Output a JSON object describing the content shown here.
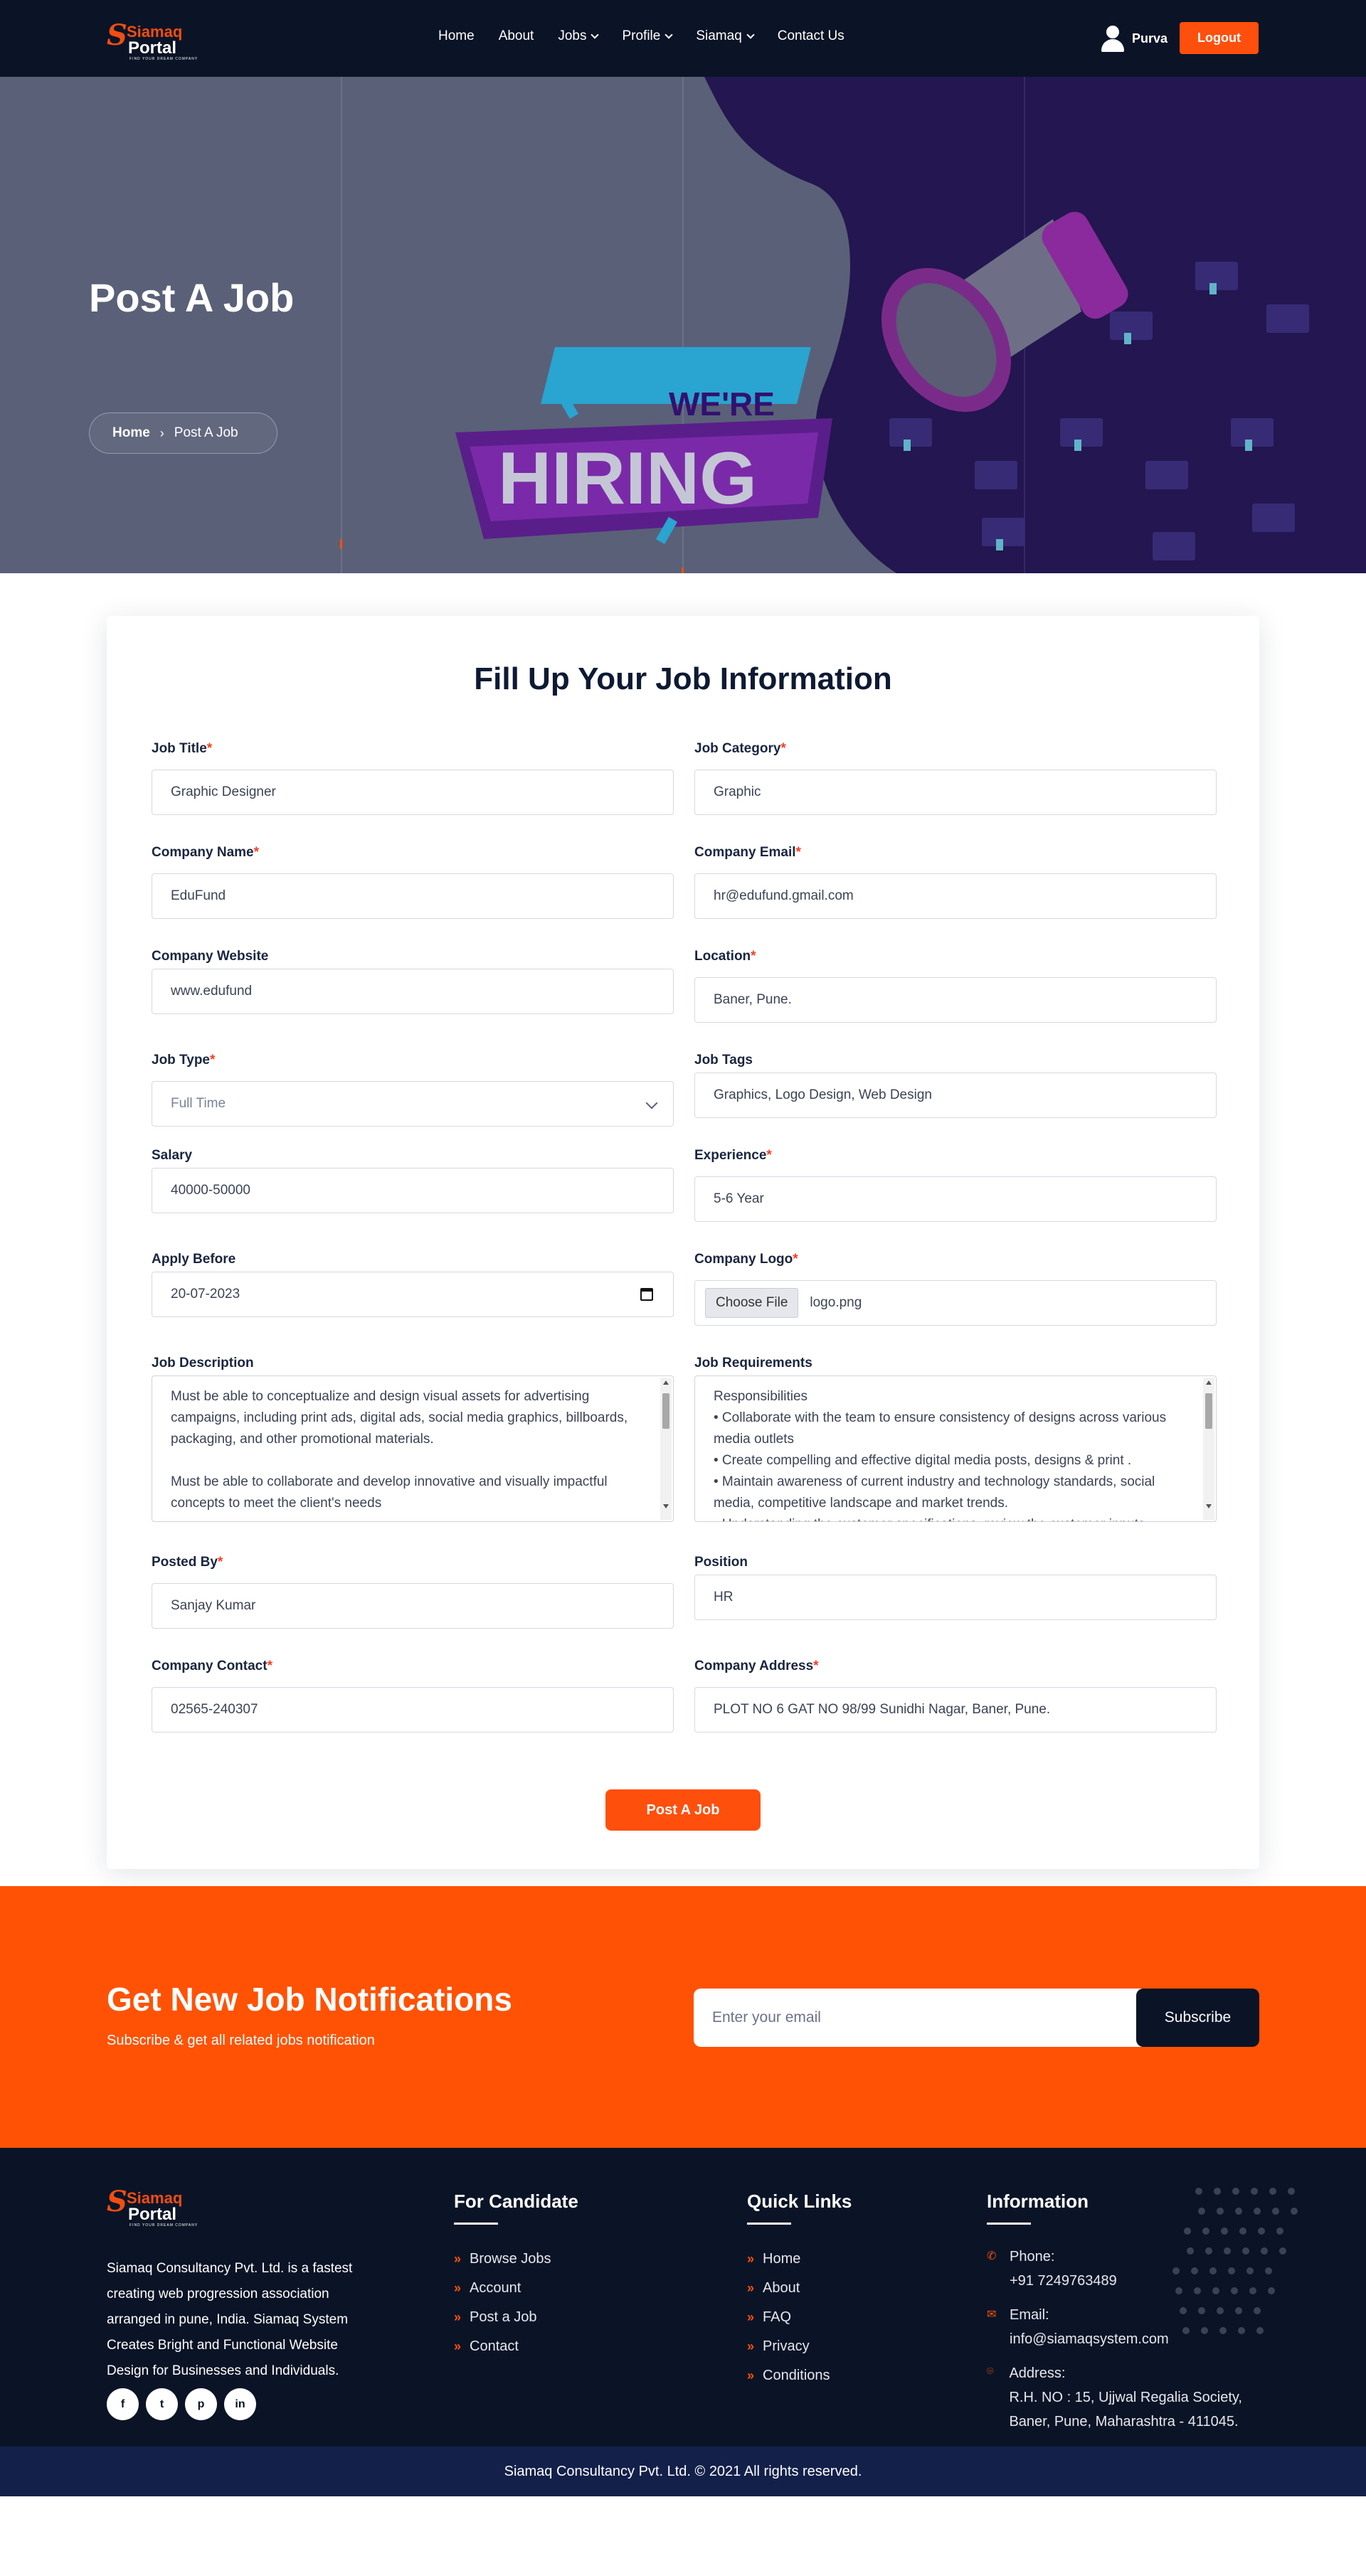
{
  "nav": {
    "logo_top": "Siamaq",
    "logo_bottom": "Portal",
    "logo_tagline": "FIND YOUR DREAM COMPANY",
    "items": [
      {
        "label": "Home",
        "dropdown": false
      },
      {
        "label": "About",
        "dropdown": false
      },
      {
        "label": "Jobs",
        "dropdown": true
      },
      {
        "label": "Profile",
        "dropdown": true
      },
      {
        "label": "Siamaq",
        "dropdown": true
      },
      {
        "label": "Contact Us",
        "dropdown": false
      }
    ],
    "user_name": "Purva",
    "logout_label": "Logout"
  },
  "hero": {
    "title": "Post A Job",
    "breadcrumb_home": "Home",
    "breadcrumb_current": "Post A Job",
    "banner_small": "WE'RE",
    "banner_big": "HIRING"
  },
  "form": {
    "heading": "Fill Up Your Job Information",
    "fields": {
      "job_title": {
        "label": "Job Title",
        "required": true,
        "value": "Graphic Designer"
      },
      "job_category": {
        "label": "Job Category",
        "required": true,
        "value": "Graphic"
      },
      "company_name": {
        "label": "Company Name",
        "required": true,
        "value": "EduFund"
      },
      "company_email": {
        "label": "Company Email",
        "required": true,
        "value": "hr@edufund.gmail.com"
      },
      "company_website": {
        "label": "Company Website",
        "required": false,
        "value": "www.edufund"
      },
      "location": {
        "label": "Location",
        "required": true,
        "value": "Baner, Pune."
      },
      "job_type": {
        "label": "Job Type",
        "required": true,
        "value": "Full Time"
      },
      "job_tags": {
        "label": "Job Tags",
        "required": false,
        "value": "Graphics, Logo Design, Web Design"
      },
      "salary": {
        "label": "Salary",
        "required": false,
        "value": "40000-50000"
      },
      "experience": {
        "label": "Experience",
        "required": true,
        "value": "5-6 Year"
      },
      "apply_before": {
        "label": "Apply Before",
        "required": false,
        "value": "20-07-2023"
      },
      "company_logo": {
        "label": "Company Logo",
        "required": true,
        "button": "Choose File",
        "value": "logo.png"
      },
      "job_description": {
        "label": "Job Description",
        "required": false,
        "value": "Must be able to conceptualize and design visual assets for advertising campaigns, including print ads, digital ads, social media graphics, billboards, packaging, and other promotional materials.\n\nMust be able to collaborate and develop innovative and visually impactful concepts to meet the client's needs"
      },
      "job_requirements": {
        "label": "Job Requirements",
        "required": false,
        "value": "Responsibilities\n• Collaborate with the team to ensure consistency of designs across various media outlets\n• Create compelling and effective digital media posts, designs & print .\n• Maintain awareness of current industry and technology standards, social media, competitive landscape and market trends.\n• Understanding the customer specifications, review the customer inputs"
      },
      "posted_by": {
        "label": "Posted By",
        "required": true,
        "value": "Sanjay Kumar"
      },
      "position": {
        "label": "Position",
        "required": false,
        "value": "HR"
      },
      "company_contact": {
        "label": "Company Contact",
        "required": true,
        "value": "02565-240307"
      },
      "company_address": {
        "label": "Company Address",
        "required": true,
        "value": "PLOT NO 6 GAT NO 98/99 Sunidhi Nagar, Baner, Pune."
      }
    },
    "submit_label": "Post A Job"
  },
  "newsletter": {
    "title": "Get New Job Notifications",
    "subtitle": "Subscribe & get all related jobs notification",
    "email_placeholder": "Enter your email",
    "button": "Subscribe"
  },
  "footer": {
    "about": "Siamaq Consultancy Pvt. Ltd. is a fastest creating web progression association arranged in pune, India. Siamaq System Creates Bright and Functional Website Design for Businesses and Individuals.",
    "socials": [
      {
        "icon": "facebook-icon",
        "glyph": "f"
      },
      {
        "icon": "twitter-icon",
        "glyph": "t"
      },
      {
        "icon": "pinterest-icon",
        "glyph": "p"
      },
      {
        "icon": "linkedin-icon",
        "glyph": "in"
      }
    ],
    "for_candidate": {
      "title": "For Candidate",
      "links": [
        "Browse Jobs",
        "Account",
        "Post a Job",
        "Contact"
      ]
    },
    "quick_links": {
      "title": "Quick Links",
      "links": [
        "Home",
        "About",
        "FAQ",
        "Privacy",
        "Conditions"
      ]
    },
    "information": {
      "title": "Information",
      "phone_label": "Phone:",
      "phone": "+91 7249763489",
      "email_label": "Email:",
      "email": "info@siamaqsystem.com",
      "address_label": "Address:",
      "address": "R.H. NO : 15, Ujjwal Regalia Society, Baner, Pune, Maharashtra - 411045."
    },
    "copyright": "Siamaq Consultancy Pvt. Ltd. © 2021 All rights reserved."
  },
  "colors": {
    "navy": "#0b1426",
    "accent": "#ff4f0d",
    "hero_gray": "#5a6078",
    "hero_purple": "#241650"
  }
}
